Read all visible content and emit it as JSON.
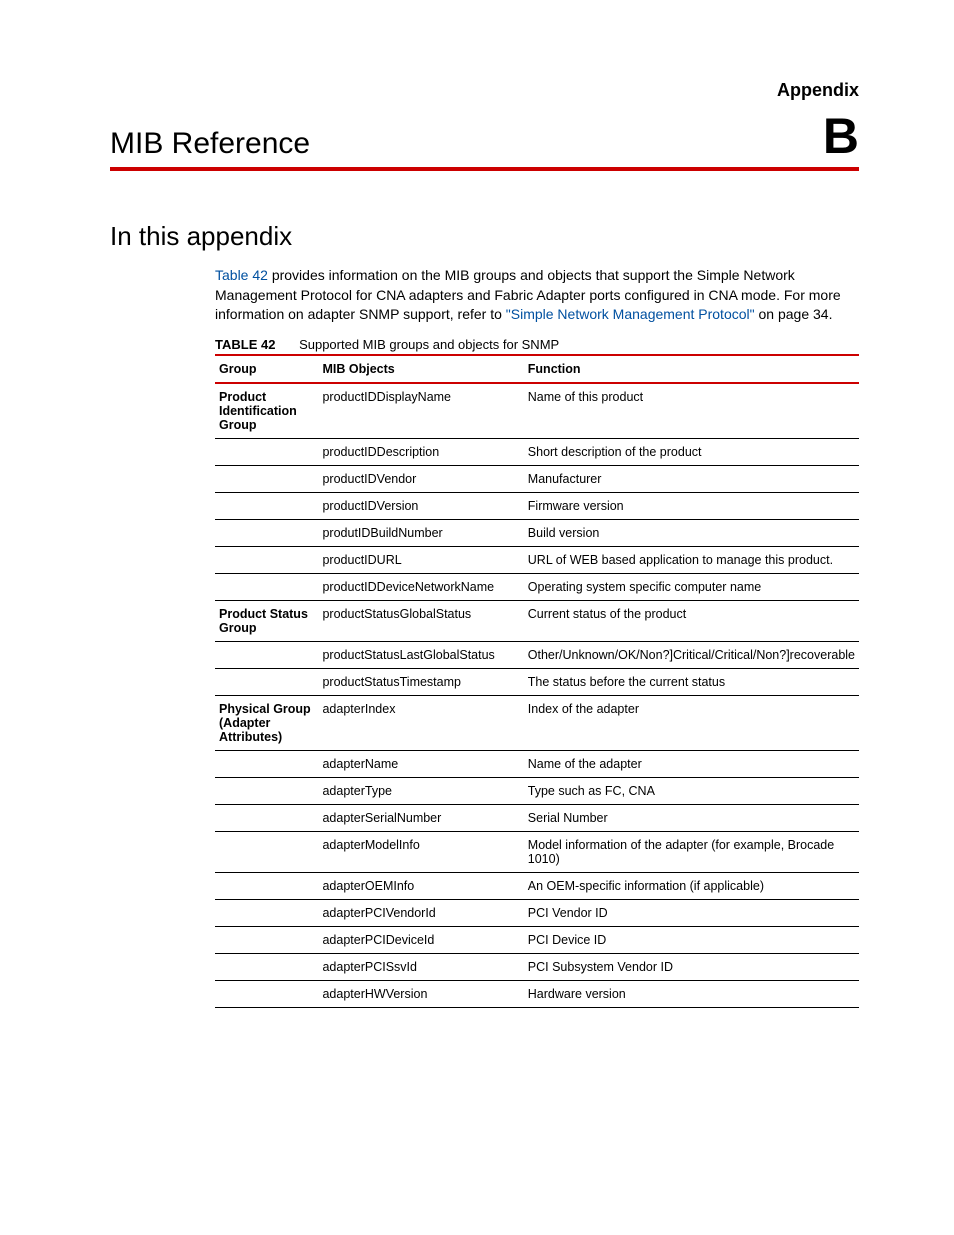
{
  "header": {
    "appendix_label": "Appendix",
    "appendix_letter": "B",
    "page_title": "MIB Reference"
  },
  "section": {
    "heading": "In this appendix",
    "para_pre": "",
    "link1": "Table 42",
    "para_mid1": " provides information on the MIB groups and objects that support the Simple Network Management Protocol for CNA adapters and Fabric Adapter ports configured in CNA mode. For more information on adapter SNMP support, refer to ",
    "link2": "\"Simple Network Management Protocol\"",
    "para_post": " on page 34."
  },
  "table": {
    "label": "TABLE 42",
    "caption": "Supported MIB groups and objects for SNMP",
    "headers": {
      "group": "Group",
      "mib": "MIB Objects",
      "func": "Function"
    },
    "rows": [
      {
        "group": "Product Identification Group",
        "obj": "productIDDisplayName",
        "func": "Name of this product"
      },
      {
        "group": "",
        "obj": "productIDDescription",
        "func": "Short description of the product"
      },
      {
        "group": "",
        "obj": "productIDVendor",
        "func": "Manufacturer"
      },
      {
        "group": "",
        "obj": "productIDVersion",
        "func": "Firmware version"
      },
      {
        "group": "",
        "obj": "produtIDBuildNumber",
        "func": "Build version"
      },
      {
        "group": "",
        "obj": "productIDURL",
        "func": "URL of WEB based application to manage this product."
      },
      {
        "group": "",
        "obj": "productIDDeviceNetworkName",
        "func": "Operating system specific computer name"
      },
      {
        "group": "Product Status Group",
        "obj": "productStatusGlobalStatus",
        "func": "Current status of the product"
      },
      {
        "group": "",
        "obj": "productStatusLastGlobalStatus",
        "func": "Other/Unknown/OK/Non?]Critical/Critical/Non?]recoverable"
      },
      {
        "group": "",
        "obj": "productStatusTimestamp",
        "func": "The status before the current status"
      },
      {
        "group": "Physical Group (Adapter Attributes)",
        "obj": "adapterIndex",
        "func": "Index of the adapter"
      },
      {
        "group": "",
        "obj": "adapterName",
        "func": "Name of the adapter"
      },
      {
        "group": "",
        "obj": "adapterType",
        "func": "Type such as FC, CNA"
      },
      {
        "group": "",
        "obj": "adapterSerialNumber",
        "func": "Serial Number"
      },
      {
        "group": "",
        "obj": "adapterModelInfo",
        "func": "Model information of the adapter (for example, Brocade 1010)"
      },
      {
        "group": "",
        "obj": "adapterOEMInfo",
        "func": "An OEM-specific information (if applicable)"
      },
      {
        "group": "",
        "obj": "adapterPCIVendorId",
        "func": "PCI Vendor ID"
      },
      {
        "group": "",
        "obj": "adapterPCIDeviceId",
        "func": "PCI Device ID"
      },
      {
        "group": "",
        "obj": "adapterPCISsvId",
        "func": "PCI Subsystem Vendor ID"
      },
      {
        "group": "",
        "obj": "adapterHWVersion",
        "func": "Hardware version"
      }
    ]
  }
}
